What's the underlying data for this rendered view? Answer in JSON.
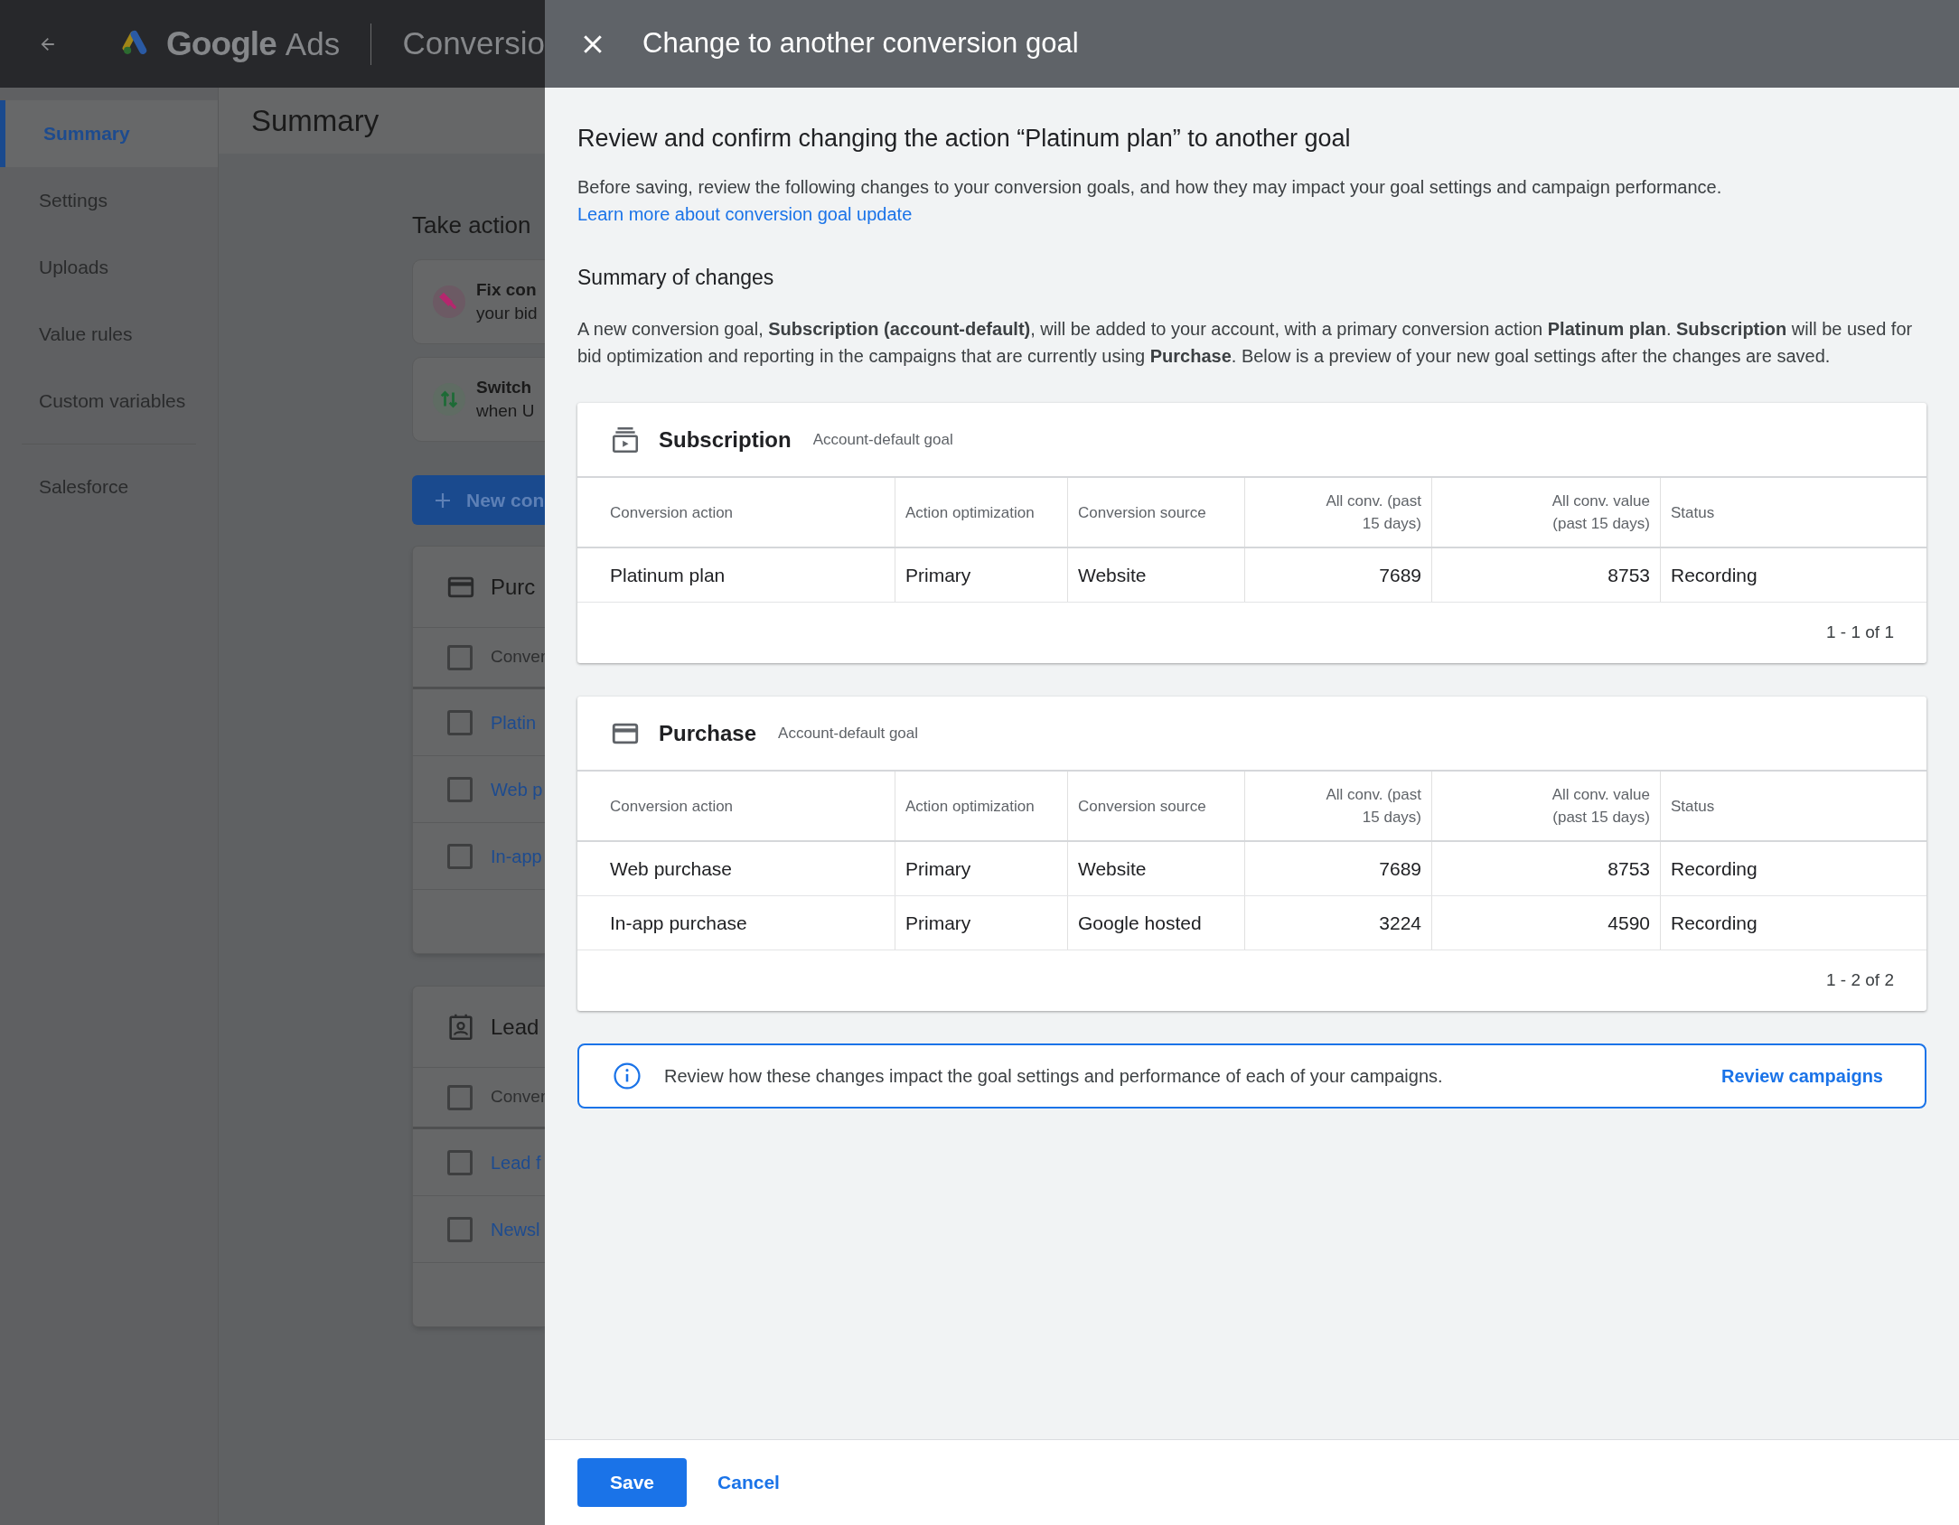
{
  "app_header": {
    "product": "Google",
    "product_suffix": "Ads",
    "page": "Conversio"
  },
  "sidebar": {
    "groups": [
      {
        "items": [
          {
            "label": "Summary",
            "selected": true
          },
          {
            "label": "Settings",
            "selected": false
          },
          {
            "label": "Uploads",
            "selected": false
          },
          {
            "label": "Value rules",
            "selected": false
          },
          {
            "label": "Custom variables",
            "selected": false
          }
        ]
      },
      {
        "items": [
          {
            "label": "Salesforce",
            "selected": false
          }
        ]
      }
    ]
  },
  "page_title": "Summary",
  "take_actions": {
    "title": "Take action",
    "cards": [
      {
        "kind": "fix",
        "lines": [
          "Fix con",
          "your bid"
        ]
      },
      {
        "kind": "switch",
        "lines": [
          "Switch",
          "when U"
        ]
      }
    ]
  },
  "new_button": "New con",
  "goal_cards": [
    {
      "kind": "purchase",
      "title": "Purc",
      "header": {
        "label": "Conver",
        "checked": false
      },
      "rows": [
        {
          "label": "Platin",
          "checked": false
        },
        {
          "label": "Web p",
          "checked": false
        },
        {
          "label": "In-app",
          "checked": false
        }
      ]
    },
    {
      "kind": "lead",
      "title": "Lead",
      "header": {
        "label": "Conver",
        "checked": false
      },
      "rows": [
        {
          "label": "Lead f",
          "checked": false
        },
        {
          "label": "Newsl",
          "checked": false
        }
      ]
    }
  ],
  "panel": {
    "title": "Change to another conversion goal",
    "heading": "Review and confirm changing the action “Platinum plan” to another goal",
    "intro": "Before saving, review the following changes to your conversion goals, and how they may impact your goal settings and campaign performance.",
    "intro_link": "Learn more about conversion goal update",
    "summary_heading": "Summary of changes",
    "summary_text": "A new conversion goal, **Subscription (account-default)**, will be added to your account, with a primary conversion action **Platinum plan**. **Subscription** will be used for bid optimization and reporting in the campaigns that are currently using **Purchase**. Below is a preview of your new goal settings after the changes are saved.",
    "goals": [
      {
        "kind": "subscription",
        "name": "Subscription",
        "tag": "Account-default goal",
        "columns": [
          "Conversion action",
          "Action optimization",
          "Conversion source",
          "All conv. (past 15 days)",
          "All conv. value (past 15 days)",
          "Status"
        ],
        "rows": [
          [
            "Platinum plan",
            "Primary",
            "Website",
            "7689",
            "8753",
            "Recording"
          ]
        ],
        "pagination": "1 - 1 of 1"
      },
      {
        "kind": "purchase",
        "name": "Purchase",
        "tag": "Account-default goal",
        "columns": [
          "Conversion action",
          "Action optimization",
          "Conversion source",
          "All conv. (past 15 days)",
          "All conv. value (past 15 days)",
          "Status"
        ],
        "rows": [
          [
            "Web purchase",
            "Primary",
            "Website",
            "7689",
            "8753",
            "Recording"
          ],
          [
            "In-app purchase",
            "Primary",
            "Google hosted",
            "3224",
            "4590",
            "Recording"
          ]
        ],
        "pagination": "1 - 2 of 2"
      }
    ],
    "info": {
      "text": "Review how these changes impact the goal settings and performance of each of your campaigns.",
      "action": "Review campaigns"
    },
    "buttons": {
      "save": "Save",
      "cancel": "Cancel"
    }
  }
}
